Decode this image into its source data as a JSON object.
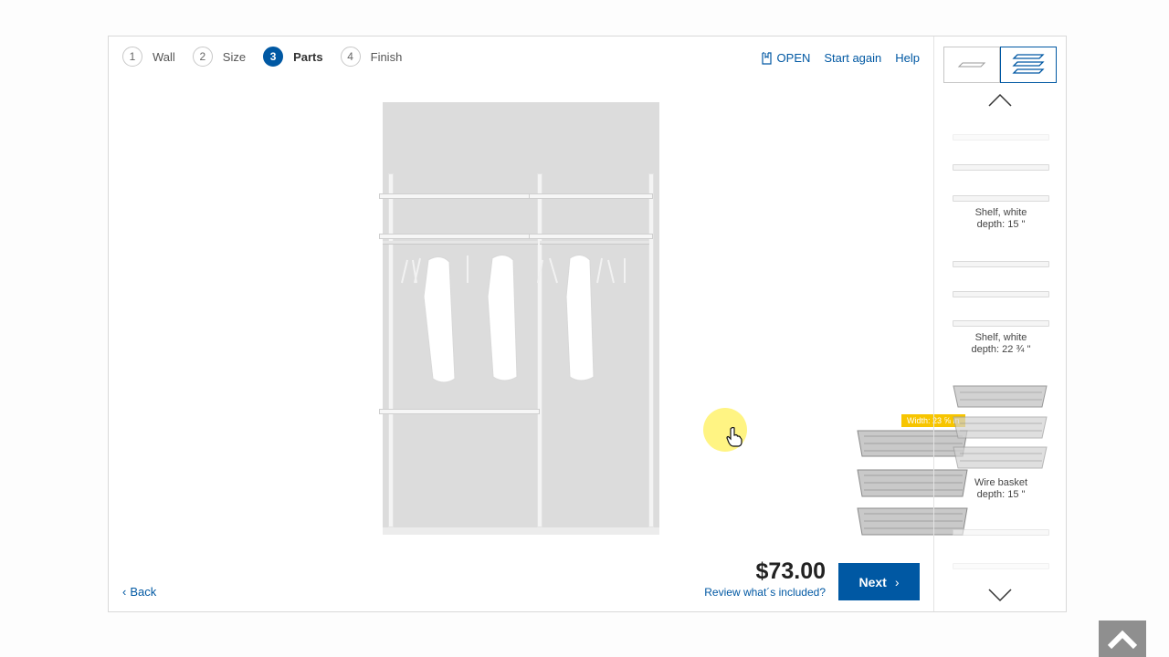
{
  "steps": [
    {
      "num": "1",
      "label": "Wall"
    },
    {
      "num": "2",
      "label": "Size"
    },
    {
      "num": "3",
      "label": "Parts"
    },
    {
      "num": "4",
      "label": "Finish"
    }
  ],
  "toplinks": {
    "open": "OPEN",
    "start_again": "Start again",
    "help": "Help"
  },
  "tooltip": "Width: 23 ⅝ in",
  "footer": {
    "back": "Back",
    "price": "$73.00",
    "review": "Review what´s included?",
    "next": "Next"
  },
  "panel": {
    "items": [
      {
        "line1": "Shelf, white",
        "line2": "depth: 15 \""
      },
      {
        "line1": "Shelf, white",
        "line2": "depth: 22 ¾ \""
      },
      {
        "line1": "Wire basket",
        "line2": "depth: 15 \""
      }
    ]
  },
  "colors": {
    "accent": "#0058a3",
    "tooltip": "#f7c500",
    "wall": "#dcdcdc"
  }
}
